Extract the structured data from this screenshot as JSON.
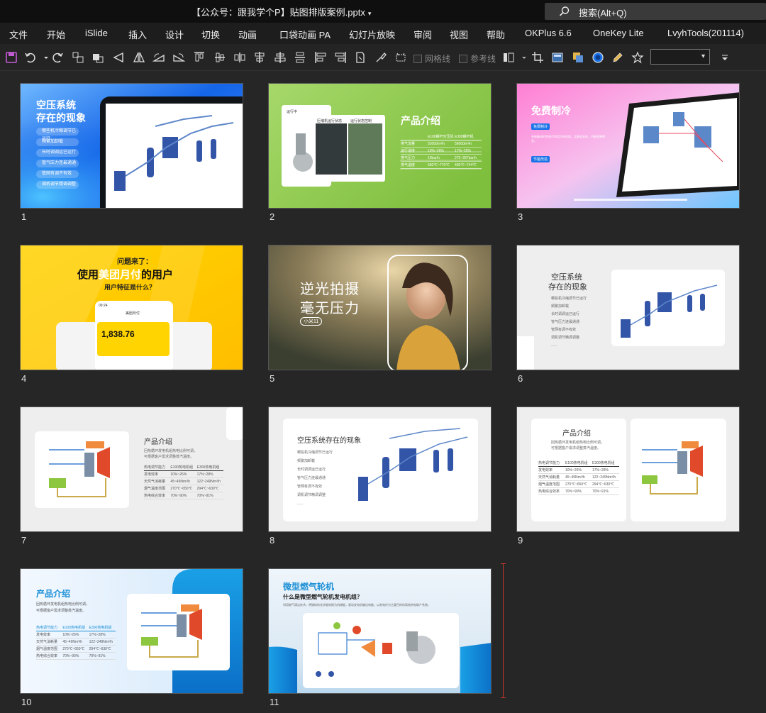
{
  "titlebar": {
    "document_title": "【公众号：跟我学个P】贴图排版案例.pptx",
    "search_label": "搜索(Alt+Q)"
  },
  "menu": [
    "文件",
    "开始",
    "iSlide",
    "插入",
    "设计",
    "切换",
    "动画",
    "口袋动画 PA",
    "幻灯片放映",
    "审阅",
    "视图",
    "帮助",
    "OKPlus 6.6",
    "OneKey Lite",
    "LvyhTools(201114)"
  ],
  "toolbar": {
    "gridlines_label": "网格线",
    "guides_label": "参考线",
    "selector_value": ""
  },
  "slides": [
    {
      "number": "1",
      "title_line1": "空压系统",
      "title_line2": "存在的现象",
      "items": [
        "哪些机冷缩调节已运行",
        "频繁加卸载",
        "长时调调运已运行",
        "管气压力连最通通",
        "管网有调不有效",
        "调机调节精调调整"
      ]
    },
    {
      "number": "2",
      "title": "产品介绍",
      "panel_left": "运行中",
      "panel_mid": "压缩机运行状态",
      "panel_right": "运行状态控制",
      "table": [
        [
          "",
          "E100螺杆空压机",
          "E300螺杆机"
        ],
        [
          "排气流量",
          "52000m³/h",
          "56000m³/h"
        ],
        [
          "运行温度",
          "10%~26%",
          "17%~26%"
        ],
        [
          "排气压力",
          "10bar/h",
          "275~287bar/h"
        ],
        [
          "排气温度",
          "650℃~770℃",
          "430℃~744℃"
        ]
      ]
    },
    {
      "number": "3",
      "title": "免费制冷",
      "tag1": "免费制冷",
      "tag2": "节能改造",
      "body": "系统集成的余热可利用冷热机组，运营成本低，节能效果明显。"
    },
    {
      "number": "4",
      "line1": "问题来了：",
      "line2_pre": "使用",
      "line2_highlight": "美团月付",
      "line2_post": "的用户",
      "line3": "用户特征是什么？",
      "amount": "1,838.76",
      "app_title": "美团月付",
      "time": "09:24"
    },
    {
      "number": "5",
      "line1": "逆光拍摄",
      "line2": "毫无压力",
      "badge": "小米11"
    },
    {
      "number": "6",
      "title_line1": "空压系统",
      "title_line2": "存在的现象",
      "items": [
        "哪些机冷缩调节已运行",
        "频繁加卸载",
        "长时调调运已运行",
        "管气压力连最通通",
        "管网有调不有效",
        "调机调节精调调整",
        "......"
      ]
    },
    {
      "number": "7",
      "title": "产品介绍",
      "subtitle1": "回热循环发电机组热电比例可调，",
      "subtitle2": "可根据客户需求调整蒸汽温度。",
      "table": [
        [
          "热电调节能力",
          "E100热电机组",
          "E300热电机组"
        ],
        [
          "发电效率",
          "10%~26%",
          "17%~28%"
        ],
        [
          "天然气消耗量",
          "45~49Nm³/h",
          "122~249Nm³/h"
        ],
        [
          "烟气温度范围",
          "270℃~650℃",
          "294℃~630℃"
        ],
        [
          "热电综合效率",
          "70%~90%",
          "70%~91%"
        ]
      ]
    },
    {
      "number": "8",
      "title": "空压系统存在的现象",
      "items": [
        "哪些机冷缩调节已运行",
        "频繁加卸载",
        "长时调调运已运行",
        "管气压力连最通通",
        "管网有调不有效",
        "调机调节精调调整",
        "......"
      ]
    },
    {
      "number": "9",
      "title": "产品介绍",
      "subtitle1": "回热循环发电机组热电比例可调，",
      "subtitle2": "可根据客户需求调整蒸汽温度。",
      "table": [
        [
          "热电调节能力",
          "E100热电机组",
          "E300热电机组"
        ],
        [
          "发电效率",
          "10%~26%",
          "17%~28%"
        ],
        [
          "天然气消耗量",
          "45~49Nm³/h",
          "122~249Nm³/h"
        ],
        [
          "烟气温度范围",
          "270℃~650℃",
          "294℃~630℃"
        ],
        [
          "热电综合效率",
          "70%~90%",
          "70%~91%"
        ]
      ]
    },
    {
      "number": "10",
      "title": "产品介绍",
      "subtitle1": "回热循环发电机组热电比例可调，",
      "subtitle2": "可根据客户需求调整蒸汽温度。",
      "table": [
        [
          "热电调节能力",
          "E100热电机组",
          "E300热电机组"
        ],
        [
          "发电效率",
          "10%~26%",
          "17%~28%"
        ],
        [
          "天然气消耗量",
          "45~49Nm³/h",
          "122~249Nm³/h"
        ],
        [
          "烟气温度范围",
          "270℃~650℃",
          "294℃~630℃"
        ],
        [
          "热电综合效率",
          "70%~90%",
          "70%~91%"
        ]
      ]
    },
    {
      "number": "11",
      "title": "微型燃气轮机",
      "subtitle": "什么是微型燃气轮机发电机组？",
      "body": "利用燃气清洁技术，将燃料的化学能转换为机械能，驱动发电机输出电能，以发电作为主要目的的高效热电联产系统。"
    }
  ],
  "colors": {
    "titlebar_bg": "#0f0f0f",
    "menubar_bg": "#1d1d1d",
    "workspace_bg": "#262626",
    "accent_yellow": "#ffcc00",
    "accent_blue": "#1a73e8"
  }
}
